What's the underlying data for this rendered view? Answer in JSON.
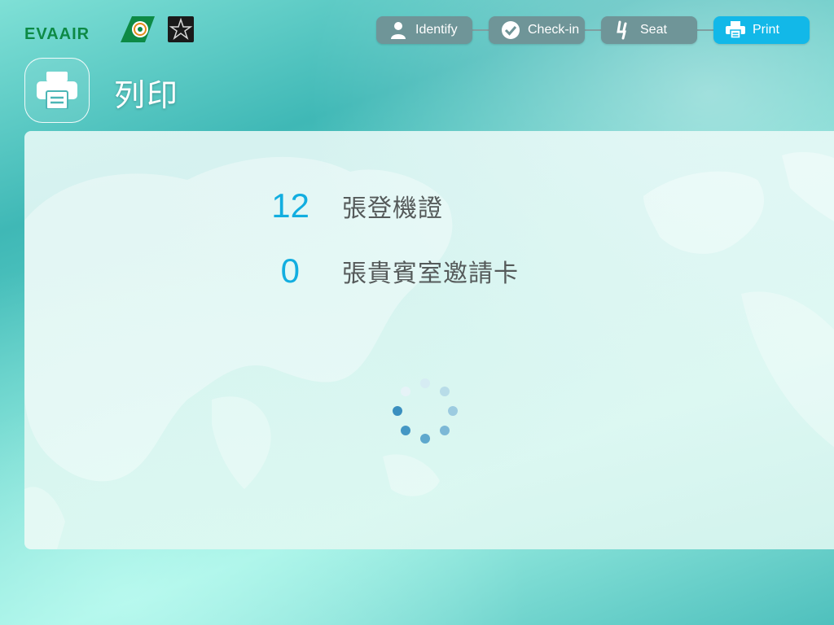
{
  "header": {
    "brand": "EVA AIR",
    "logo_text": "EVAAIR",
    "alliance_logo": "star-alliance-logo"
  },
  "steps": [
    {
      "label": "Identify",
      "icon": "person-icon",
      "active": false
    },
    {
      "label": "Check-in",
      "icon": "check-circle-icon",
      "active": false
    },
    {
      "label": "Seat",
      "icon": "seat-icon",
      "active": false
    },
    {
      "label": "Print",
      "icon": "printer-icon",
      "active": true
    }
  ],
  "page": {
    "title": "列印",
    "title_icon": "printer-icon"
  },
  "summary": [
    {
      "count": "12",
      "label": "張登機證"
    },
    {
      "count": "0",
      "label": "張貴賓室邀請卡"
    }
  ],
  "status": {
    "loading": true
  },
  "colors": {
    "accent": "#12b8e8",
    "step_inactive": "#6f9598",
    "count": "#12aee0",
    "brand_green": "#0d8a45"
  }
}
